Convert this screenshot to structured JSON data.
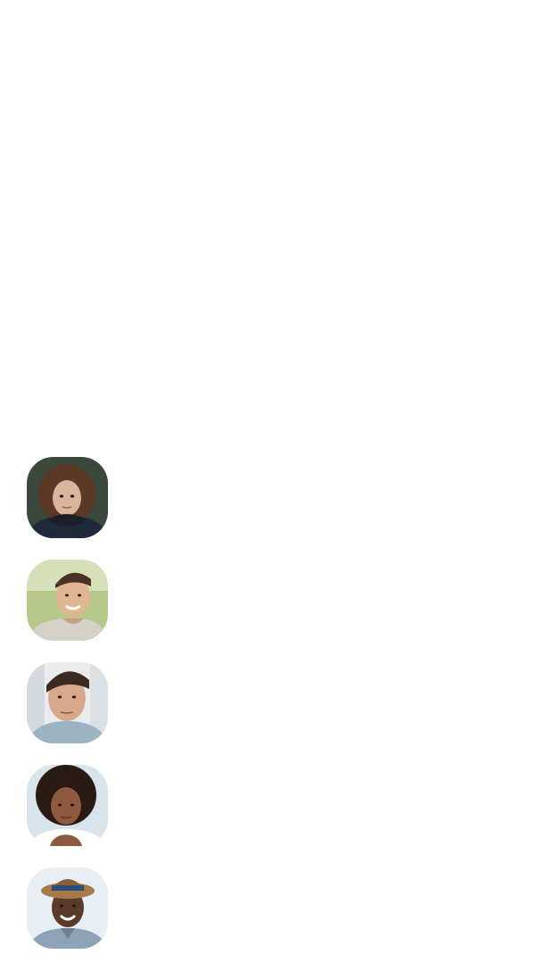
{
  "avatars": [
    {
      "name": "avatar-woman-curly-brown",
      "bg": "#4b5a4a",
      "skin": "#d9b59c",
      "hair": "#5a3a26",
      "shirt": "#1f2a3a"
    },
    {
      "name": "avatar-man-smiling-outdoor",
      "bg": "#b7c98a",
      "skin": "#e2b592",
      "hair": "#4a3226",
      "shirt": "#d7d2c8"
    },
    {
      "name": "avatar-man-serious",
      "bg": "#e9ecef",
      "skin": "#d8a88b",
      "hair": "#3a2a22",
      "shirt": "#9bb3c2"
    },
    {
      "name": "avatar-woman-afro",
      "bg": "#dfe9ef",
      "skin": "#8d5a3f",
      "hair": "#2a1a14",
      "shirt": "#ffffff"
    },
    {
      "name": "avatar-man-hat-smiling",
      "bg": "#dfe8ef",
      "skin": "#5a3a2a",
      "hair": "#1f1712",
      "shirt": "#8ea2b8",
      "hat": "#a77a4a"
    }
  ]
}
